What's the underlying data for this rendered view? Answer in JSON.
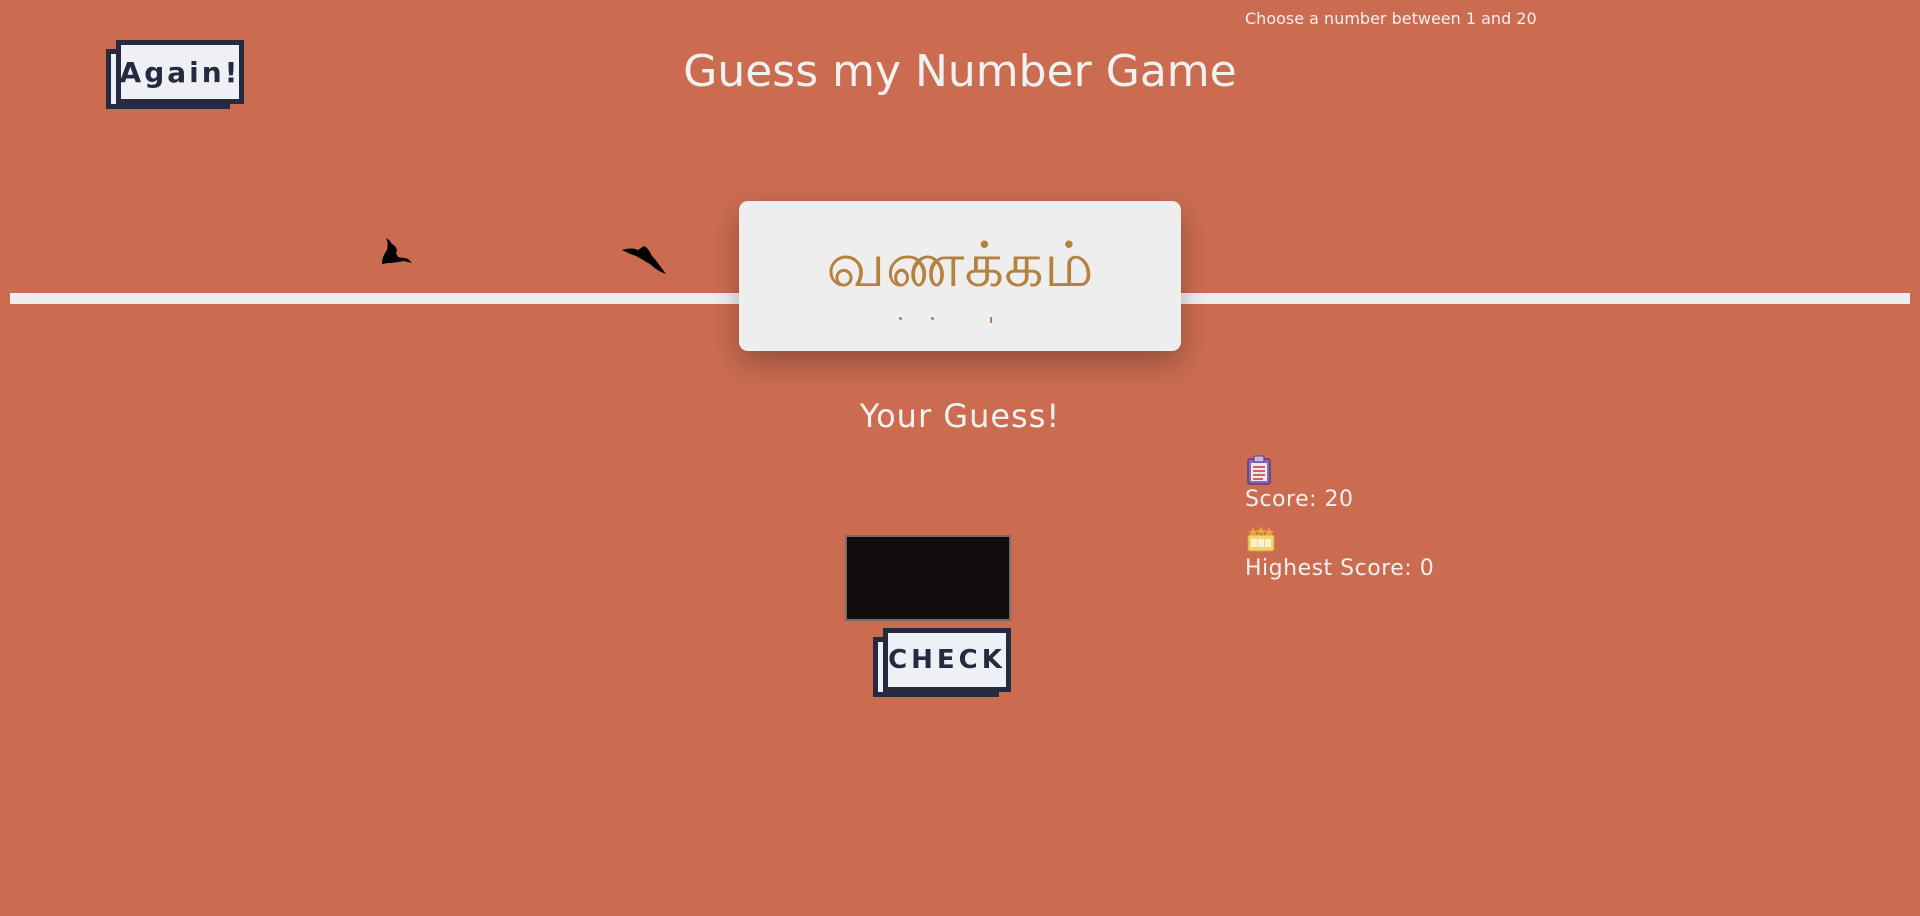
{
  "header": {
    "again_label": "Again!",
    "title": "Guess my Number Game",
    "hint": "Choose a number between 1 and 20"
  },
  "secret": {
    "display": "வணக்கம்"
  },
  "guess": {
    "label": "Your Guess!",
    "value": "",
    "check_label": "CHECK"
  },
  "stats": {
    "score_icon": "clipboard-icon",
    "score_text": "Score: 20",
    "highscore_icon": "trophy-stars-icon",
    "highscore_text": "Highest Score: 0"
  },
  "colors": {
    "background": "#cb6c51",
    "secret_text": "#b5813e",
    "button_border": "#262a40",
    "button_fill": "#eef0f6"
  }
}
